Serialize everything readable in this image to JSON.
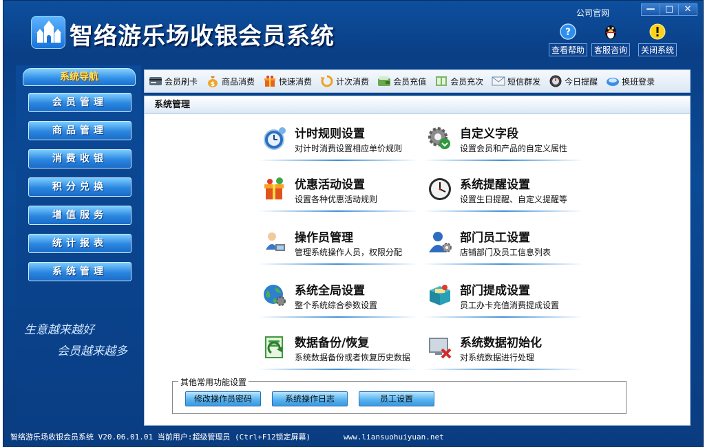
{
  "header": {
    "title": "智络游乐场收银会员系统",
    "official_link": "公司官网",
    "window_controls": [
      "—",
      "□",
      "✕"
    ],
    "buttons": [
      {
        "label": "查看帮助",
        "icon": "help-icon"
      },
      {
        "label": "客服咨询",
        "icon": "qq-penguin-icon"
      },
      {
        "label": "关闭系统",
        "icon": "warning-icon"
      }
    ]
  },
  "sidebar": {
    "title": "系统导航",
    "items": [
      {
        "label": "会员管理"
      },
      {
        "label": "商品管理"
      },
      {
        "label": "消费收银"
      },
      {
        "label": "积分兑换"
      },
      {
        "label": "增值服务"
      },
      {
        "label": "统计报表"
      },
      {
        "label": "系统管理"
      }
    ],
    "slogan_line1": "生意越来越好",
    "slogan_line2": "会员越来越多"
  },
  "toolbar": {
    "items": [
      {
        "label": "会员刷卡",
        "icon": "card-reader-icon"
      },
      {
        "label": "商品消费",
        "icon": "money-bag-icon"
      },
      {
        "label": "快速消费",
        "icon": "gift-icon"
      },
      {
        "label": "计次消费",
        "icon": "refresh-icon"
      },
      {
        "label": "会员充值",
        "icon": "wallet-icon"
      },
      {
        "label": "会员充次",
        "icon": "ledger-icon"
      },
      {
        "label": "短信群发",
        "icon": "mail-icon"
      },
      {
        "label": "今日提醒",
        "icon": "clock-icon"
      },
      {
        "label": "换班登录",
        "icon": "swap-icon"
      }
    ]
  },
  "main": {
    "header": "系统管理",
    "cards": [
      {
        "title": "计时规则设置",
        "desc": "对计时消费设置相应单价规则",
        "icon": "timer-icon"
      },
      {
        "title": "自定义字段",
        "desc": "设置会员和产品的自定义属性",
        "icon": "gear-download-icon"
      },
      {
        "title": "优惠活动设置",
        "desc": "设置各种优惠活动规则",
        "icon": "gift-box-icon"
      },
      {
        "title": "系统提醒设置",
        "desc": "设置生日提醒、自定义提醒等",
        "icon": "clock-icon"
      },
      {
        "title": "操作员管理",
        "desc": "管理系统操作人员，权限分配",
        "icon": "operator-icon"
      },
      {
        "title": "部门员工设置",
        "desc": "店铺部门及员工信息列表",
        "icon": "user-gear-icon"
      },
      {
        "title": "系统全局设置",
        "desc": "整个系统综合参数设置",
        "icon": "globe-gear-icon"
      },
      {
        "title": "部门提成设置",
        "desc": "员工办卡充值消费提成设置",
        "icon": "money-box-icon"
      },
      {
        "title": "数据备份/恢复",
        "desc": "系统数据备份或者恢复历史数据",
        "icon": "backup-icon"
      },
      {
        "title": "系统数据初始化",
        "desc": "对系统数据进行处理",
        "icon": "delete-data-icon"
      }
    ],
    "other_title": "其他常用功能设置",
    "other_buttons": [
      {
        "label": "修改操作员密码"
      },
      {
        "label": "系统操作日志"
      },
      {
        "label": "员工设置"
      }
    ]
  },
  "statusbar": {
    "text": "智络游乐场收银会员系统 V20.06.01.01 当前用户:超级管理员 (Ctrl+F12锁定屏幕)",
    "site": "www.liansuohuiyuan.net"
  }
}
